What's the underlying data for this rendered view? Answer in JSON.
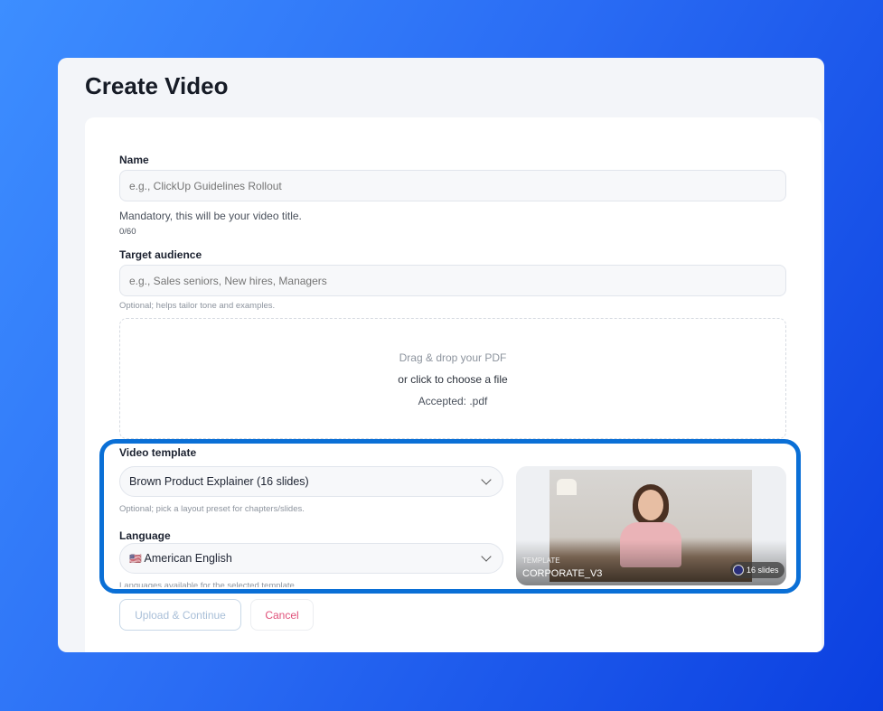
{
  "page": {
    "title": "Create Video"
  },
  "form": {
    "name": {
      "label": "Name",
      "placeholder": "e.g., ClickUp Guidelines Rollout",
      "help": "Mandatory, this will be your video title.",
      "counter": "0/60"
    },
    "audience": {
      "label": "Target audience",
      "placeholder": "e.g., Sales seniors, New hires, Managers",
      "help": "Optional; helps tailor tone and examples."
    },
    "dropzone": {
      "line1": "Drag & drop your PDF",
      "line2": "or click to choose a file",
      "line3": "Accepted: .pdf"
    },
    "template": {
      "label": "Video template",
      "value": "Brown Product Explainer (16 slides)",
      "help": "Optional; pick a layout preset for chapters/slides."
    },
    "language": {
      "label": "Language",
      "flag": "🇺🇸",
      "value": "American English",
      "help": "Languages available for the selected template."
    },
    "preview": {
      "kicker": "TEMPLATE",
      "name": "CORPORATE_V3",
      "slides": "16 slides"
    },
    "buttons": {
      "upload": "Upload & Continue",
      "cancel": "Cancel"
    }
  },
  "colors": {
    "highlight": "#0a6fd6",
    "cancel": "#e0517a",
    "upload": "#a9bfd8"
  }
}
